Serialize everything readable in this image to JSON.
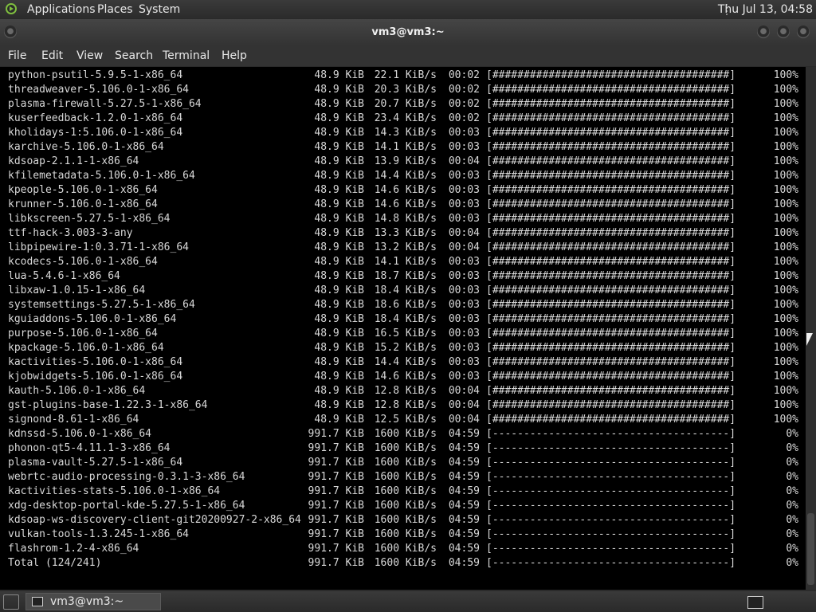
{
  "top_panel": {
    "menus": [
      "Applications",
      "Places",
      "System"
    ],
    "clock": "Thu Jul 13, 04:58"
  },
  "window": {
    "title": "vm3@vm3:~",
    "menus": [
      "File",
      "Edit",
      "View",
      "Search",
      "Terminal",
      "Help"
    ]
  },
  "terminal": {
    "rows": [
      {
        "name": "python-psutil-5.9.5-1-x86_64",
        "size": "48.9 KiB",
        "speed": "22.1 KiB/s",
        "eta": "00:02",
        "bar": "[######################################]",
        "pct": "100%"
      },
      {
        "name": "threadweaver-5.106.0-1-x86_64",
        "size": "48.9 KiB",
        "speed": "20.3 KiB/s",
        "eta": "00:02",
        "bar": "[######################################]",
        "pct": "100%"
      },
      {
        "name": "plasma-firewall-5.27.5-1-x86_64",
        "size": "48.9 KiB",
        "speed": "20.7 KiB/s",
        "eta": "00:02",
        "bar": "[######################################]",
        "pct": "100%"
      },
      {
        "name": "kuserfeedback-1.2.0-1-x86_64",
        "size": "48.9 KiB",
        "speed": "23.4 KiB/s",
        "eta": "00:02",
        "bar": "[######################################]",
        "pct": "100%"
      },
      {
        "name": "kholidays-1:5.106.0-1-x86_64",
        "size": "48.9 KiB",
        "speed": "14.3 KiB/s",
        "eta": "00:03",
        "bar": "[######################################]",
        "pct": "100%"
      },
      {
        "name": "karchive-5.106.0-1-x86_64",
        "size": "48.9 KiB",
        "speed": "14.1 KiB/s",
        "eta": "00:03",
        "bar": "[######################################]",
        "pct": "100%"
      },
      {
        "name": "kdsoap-2.1.1-1-x86_64",
        "size": "48.9 KiB",
        "speed": "13.9 KiB/s",
        "eta": "00:04",
        "bar": "[######################################]",
        "pct": "100%"
      },
      {
        "name": "kfilemetadata-5.106.0-1-x86_64",
        "size": "48.9 KiB",
        "speed": "14.4 KiB/s",
        "eta": "00:03",
        "bar": "[######################################]",
        "pct": "100%"
      },
      {
        "name": "kpeople-5.106.0-1-x86_64",
        "size": "48.9 KiB",
        "speed": "14.6 KiB/s",
        "eta": "00:03",
        "bar": "[######################################]",
        "pct": "100%"
      },
      {
        "name": "krunner-5.106.0-1-x86_64",
        "size": "48.9 KiB",
        "speed": "14.6 KiB/s",
        "eta": "00:03",
        "bar": "[######################################]",
        "pct": "100%"
      },
      {
        "name": "libkscreen-5.27.5-1-x86_64",
        "size": "48.9 KiB",
        "speed": "14.8 KiB/s",
        "eta": "00:03",
        "bar": "[######################################]",
        "pct": "100%"
      },
      {
        "name": "ttf-hack-3.003-3-any",
        "size": "48.9 KiB",
        "speed": "13.3 KiB/s",
        "eta": "00:04",
        "bar": "[######################################]",
        "pct": "100%"
      },
      {
        "name": "libpipewire-1:0.3.71-1-x86_64",
        "size": "48.9 KiB",
        "speed": "13.2 KiB/s",
        "eta": "00:04",
        "bar": "[######################################]",
        "pct": "100%"
      },
      {
        "name": "kcodecs-5.106.0-1-x86_64",
        "size": "48.9 KiB",
        "speed": "14.1 KiB/s",
        "eta": "00:03",
        "bar": "[######################################]",
        "pct": "100%"
      },
      {
        "name": "lua-5.4.6-1-x86_64",
        "size": "48.9 KiB",
        "speed": "18.7 KiB/s",
        "eta": "00:03",
        "bar": "[######################################]",
        "pct": "100%"
      },
      {
        "name": "libxaw-1.0.15-1-x86_64",
        "size": "48.9 KiB",
        "speed": "18.4 KiB/s",
        "eta": "00:03",
        "bar": "[######################################]",
        "pct": "100%"
      },
      {
        "name": "systemsettings-5.27.5-1-x86_64",
        "size": "48.9 KiB",
        "speed": "18.6 KiB/s",
        "eta": "00:03",
        "bar": "[######################################]",
        "pct": "100%"
      },
      {
        "name": "kguiaddons-5.106.0-1-x86_64",
        "size": "48.9 KiB",
        "speed": "18.4 KiB/s",
        "eta": "00:03",
        "bar": "[######################################]",
        "pct": "100%"
      },
      {
        "name": "purpose-5.106.0-1-x86_64",
        "size": "48.9 KiB",
        "speed": "16.5 KiB/s",
        "eta": "00:03",
        "bar": "[######################################]",
        "pct": "100%"
      },
      {
        "name": "kpackage-5.106.0-1-x86_64",
        "size": "48.9 KiB",
        "speed": "15.2 KiB/s",
        "eta": "00:03",
        "bar": "[######################################]",
        "pct": "100%"
      },
      {
        "name": "kactivities-5.106.0-1-x86_64",
        "size": "48.9 KiB",
        "speed": "14.4 KiB/s",
        "eta": "00:03",
        "bar": "[######################################]",
        "pct": "100%"
      },
      {
        "name": "kjobwidgets-5.106.0-1-x86_64",
        "size": "48.9 KiB",
        "speed": "14.6 KiB/s",
        "eta": "00:03",
        "bar": "[######################################]",
        "pct": "100%"
      },
      {
        "name": "kauth-5.106.0-1-x86_64",
        "size": "48.9 KiB",
        "speed": "12.8 KiB/s",
        "eta": "00:04",
        "bar": "[######################################]",
        "pct": "100%"
      },
      {
        "name": "gst-plugins-base-1.22.3-1-x86_64",
        "size": "48.9 KiB",
        "speed": "12.8 KiB/s",
        "eta": "00:04",
        "bar": "[######################################]",
        "pct": "100%"
      },
      {
        "name": "signond-8.61-1-x86_64",
        "size": "48.9 KiB",
        "speed": "12.5 KiB/s",
        "eta": "00:04",
        "bar": "[######################################]",
        "pct": "100%"
      },
      {
        "name": "kdnssd-5.106.0-1-x86_64",
        "size": "991.7 KiB",
        "speed": "1600 KiB/s",
        "eta": "04:59",
        "bar": "[--------------------------------------]",
        "pct": "0%"
      },
      {
        "name": "phonon-qt5-4.11.1-3-x86_64",
        "size": "991.7 KiB",
        "speed": "1600 KiB/s",
        "eta": "04:59",
        "bar": "[--------------------------------------]",
        "pct": "0%"
      },
      {
        "name": "plasma-vault-5.27.5-1-x86_64",
        "size": "991.7 KiB",
        "speed": "1600 KiB/s",
        "eta": "04:59",
        "bar": "[--------------------------------------]",
        "pct": "0%"
      },
      {
        "name": "webrtc-audio-processing-0.3.1-3-x86_64",
        "size": "991.7 KiB",
        "speed": "1600 KiB/s",
        "eta": "04:59",
        "bar": "[--------------------------------------]",
        "pct": "0%"
      },
      {
        "name": "kactivities-stats-5.106.0-1-x86_64",
        "size": "991.7 KiB",
        "speed": "1600 KiB/s",
        "eta": "04:59",
        "bar": "[--------------------------------------]",
        "pct": "0%"
      },
      {
        "name": "xdg-desktop-portal-kde-5.27.5-1-x86_64",
        "size": "991.7 KiB",
        "speed": "1600 KiB/s",
        "eta": "04:59",
        "bar": "[--------------------------------------]",
        "pct": "0%"
      },
      {
        "name": "kdsoap-ws-discovery-client-git20200927-2-x86_64",
        "size": "991.7 KiB",
        "speed": "1600 KiB/s",
        "eta": "04:59",
        "bar": "[--------------------------------------]",
        "pct": "0%"
      },
      {
        "name": "vulkan-tools-1.3.245-1-x86_64",
        "size": "991.7 KiB",
        "speed": "1600 KiB/s",
        "eta": "04:59",
        "bar": "[--------------------------------------]",
        "pct": "0%"
      },
      {
        "name": "flashrom-1.2-4-x86_64",
        "size": "991.7 KiB",
        "speed": "1600 KiB/s",
        "eta": "04:59",
        "bar": "[--------------------------------------]",
        "pct": "0%"
      },
      {
        "name": "Total (124/241)",
        "size": "991.7 KiB",
        "speed": "1600 KiB/s",
        "eta": "04:59",
        "bar": "[--------------------------------------]",
        "pct": "0%"
      }
    ]
  },
  "taskbar": {
    "window_button": "vm3@vm3:~"
  },
  "icons": {
    "logo": "distro-logo-icon",
    "terminal": "terminal-icon",
    "desktop": "show-desktop-icon"
  },
  "colors": {
    "terminal_bg": "#000000",
    "terminal_fg": "#d8d8d8",
    "panel_bg": "#2a2a2a",
    "logo_accent": "#7fbf3f"
  }
}
